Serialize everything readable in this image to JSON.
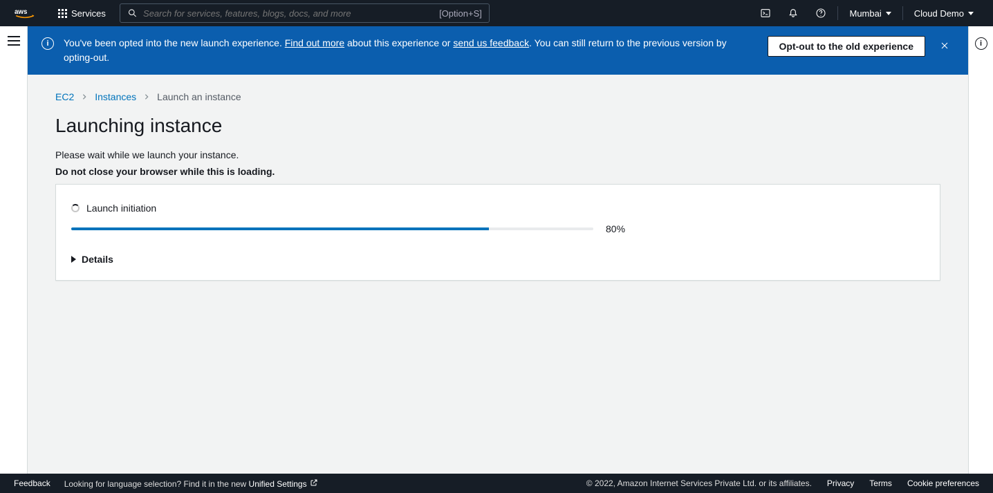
{
  "topnav": {
    "services_label": "Services",
    "search_placeholder": "Search for services, features, blogs, docs, and more",
    "search_shortcut": "[Option+S]",
    "region_label": "Mumbai",
    "account_label": "Cloud Demo"
  },
  "banner": {
    "text_prefix": "You've been opted into the new launch experience. ",
    "link_findout": "Find out more",
    "text_mid": " about this experience or ",
    "link_feedback": "send us feedback",
    "text_suffix": ". You can still return to the previous version by opting-out.",
    "optout_button": "Opt-out to the old experience"
  },
  "breadcrumb": {
    "items": [
      {
        "label": "EC2",
        "link": true
      },
      {
        "label": "Instances",
        "link": true
      },
      {
        "label": "Launch an instance",
        "link": false
      }
    ]
  },
  "page": {
    "title": "Launching instance",
    "sub1": "Please wait while we launch your instance.",
    "sub2": "Do not close your browser while this is loading."
  },
  "progress": {
    "step_label": "Launch initiation",
    "percent": 80,
    "percent_label": "80%",
    "details_label": "Details"
  },
  "footer": {
    "feedback": "Feedback",
    "lang_prefix": "Looking for language selection? Find it in the new ",
    "lang_link": "Unified Settings",
    "copyright": "© 2022, Amazon Internet Services Private Ltd. or its affiliates.",
    "privacy": "Privacy",
    "terms": "Terms",
    "cookies": "Cookie preferences"
  }
}
